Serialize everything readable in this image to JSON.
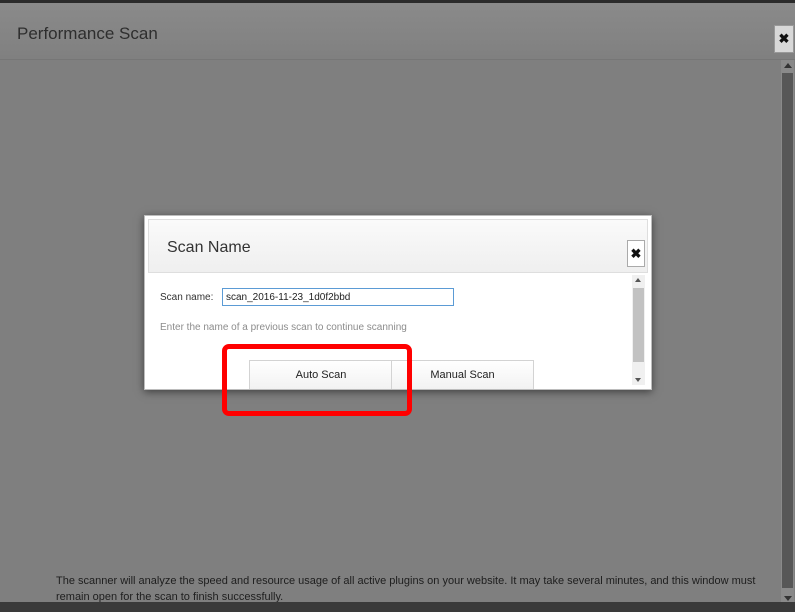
{
  "outer_window": {
    "title": "Performance Scan",
    "close_glyph": "✖",
    "note": "The scanner will analyze the speed and resource usage of all active plugins on your website. It may take several minutes, and this window must remain open for the scan to finish successfully."
  },
  "dialog": {
    "title": "Scan Name",
    "close_glyph": "✖",
    "field_label": "Scan name:",
    "field_value": "scan_2016-11-23_1d0f2bbd",
    "hint": "Enter the name of a previous scan to continue scanning",
    "auto_scan_label": "Auto Scan",
    "manual_scan_label": "Manual Scan"
  },
  "annotation": {
    "highlight_color": "#ff0000"
  }
}
